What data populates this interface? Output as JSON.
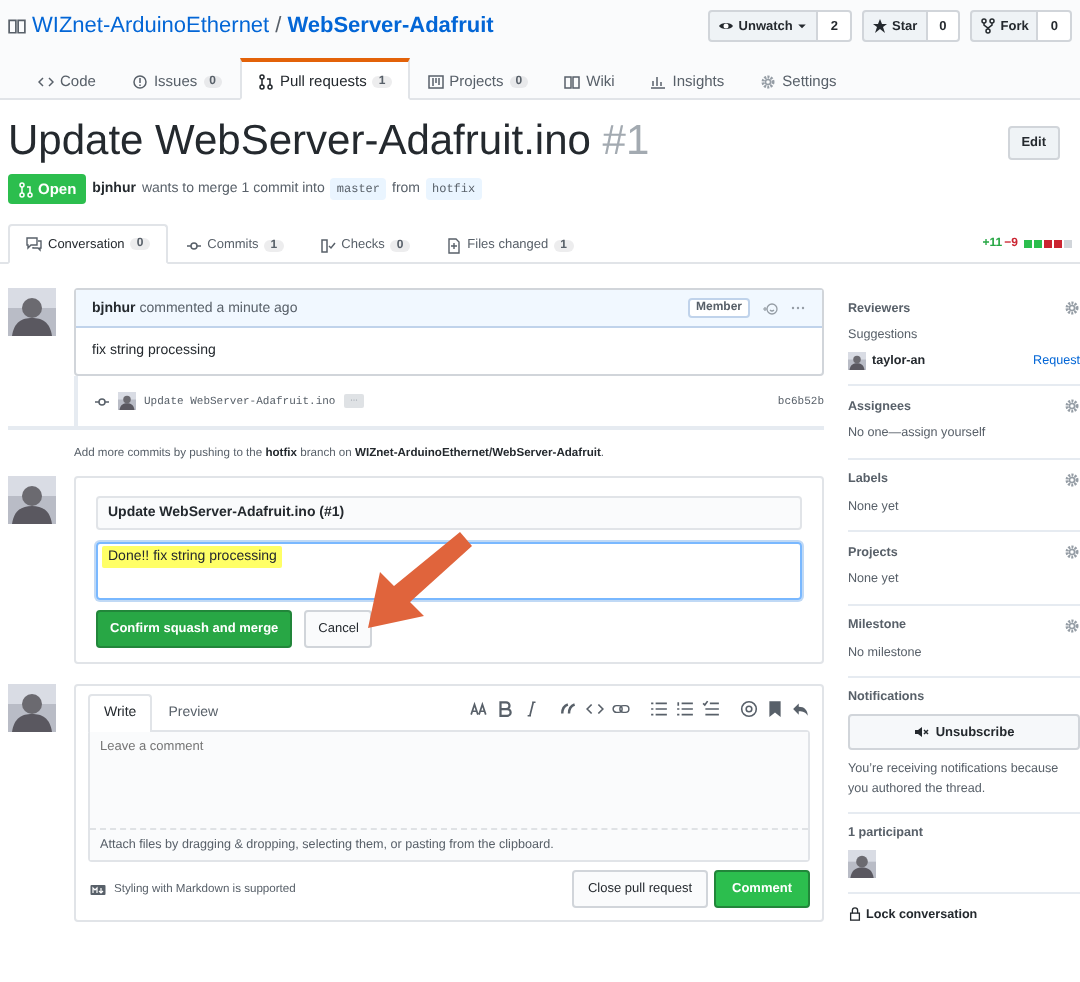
{
  "repo": {
    "owner": "WIZnet-ArduinoEthernet",
    "separator": "/",
    "name": "WebServer-Adafruit"
  },
  "repo_actions": [
    {
      "kind": "watch",
      "label": "Unwatch",
      "count": "2",
      "dropdown": true
    },
    {
      "kind": "star",
      "label": "Star",
      "count": "0",
      "dropdown": false
    },
    {
      "kind": "fork",
      "label": "Fork",
      "count": "0",
      "dropdown": false
    }
  ],
  "repo_tabs": [
    {
      "kind": "code",
      "label": "Code",
      "selected": false
    },
    {
      "kind": "issues",
      "label": "Issues",
      "count": "0",
      "selected": false
    },
    {
      "kind": "pulls",
      "label": "Pull requests",
      "count": "1",
      "selected": true
    },
    {
      "kind": "projects",
      "label": "Projects",
      "count": "0",
      "selected": false
    },
    {
      "kind": "wiki",
      "label": "Wiki",
      "selected": false
    },
    {
      "kind": "insights",
      "label": "Insights",
      "selected": false
    },
    {
      "kind": "settings",
      "label": "Settings",
      "selected": false
    }
  ],
  "pull_request": {
    "title": "Update WebServer-Adafruit.ino",
    "number": "#1",
    "edit_button": "Edit",
    "state": "Open",
    "author": "bjnhur",
    "summary": "wants to merge 1 commit into",
    "base": "master",
    "from_word": "from",
    "head": "hotfix"
  },
  "pr_tabs": [
    {
      "kind": "conversation",
      "label": "Conversation",
      "count": "0",
      "selected": true
    },
    {
      "kind": "commits",
      "label": "Commits",
      "count": "1",
      "selected": false
    },
    {
      "kind": "checks",
      "label": "Checks",
      "count": "0",
      "selected": false
    },
    {
      "kind": "files",
      "label": "Files changed",
      "count": "1",
      "selected": false
    }
  ],
  "diffstat": {
    "additions": "+11",
    "deletions": "−9",
    "blocks": [
      {
        "color": "#2cbe4e"
      },
      {
        "color": "#2cbe4e"
      },
      {
        "color": "#cb2431"
      },
      {
        "color": "#cb2431"
      },
      {
        "color": "#d1d5da"
      }
    ]
  },
  "comment": {
    "author": "bjnhur",
    "action": "commented a minute ago",
    "badge": "Member",
    "body": "fix string processing"
  },
  "commits": [
    {
      "message": "Update WebServer-Adafruit.ino",
      "sha": "bc6b52b"
    }
  ],
  "push_hint": "Add more commits by pushing to the **hotfix** branch on **WIZnet-ArduinoEthernet/WebServer-Adafruit**.",
  "merge_form": {
    "commit_title": "Update WebServer-Adafruit.ino (#1)",
    "message": "Done!! fix string processing",
    "message_highlighted": true,
    "confirm_button": "Confirm squash and merge",
    "cancel_button": "Cancel",
    "pointer_arrow": true
  },
  "comment_form": {
    "tabs": [
      {
        "label": "Write",
        "selected": true
      },
      {
        "label": "Preview",
        "selected": false
      }
    ],
    "placeholder": "Leave a comment",
    "attach_hint": "Attach files by dragging & dropping, selecting them, or pasting from the clipboard.",
    "markdown_note": "Styling with Markdown is supported",
    "close_button": "Close pull request",
    "comment_button": "Comment"
  },
  "sidebar": [
    {
      "kind": "reviewers",
      "heading": "Reviewers",
      "gear": true,
      "subheading": "Suggestions",
      "people": [
        {
          "name": "taylor-an",
          "action": "Request"
        }
      ]
    },
    {
      "kind": "text",
      "heading": "Assignees",
      "gear": true,
      "text": "No one—assign yourself"
    },
    {
      "kind": "text",
      "heading": "Labels",
      "gear": true,
      "text": "None yet"
    },
    {
      "kind": "text",
      "heading": "Projects",
      "gear": true,
      "text": "None yet"
    },
    {
      "kind": "text",
      "heading": "Milestone",
      "gear": true,
      "text": "No milestone"
    },
    {
      "kind": "notifications",
      "heading": "Notifications",
      "button": "Unsubscribe",
      "text": "You’re receiving notifications because you authored the thread."
    },
    {
      "kind": "participants",
      "heading": "1 participant"
    },
    {
      "kind": "lock",
      "text": "Lock conversation"
    }
  ]
}
